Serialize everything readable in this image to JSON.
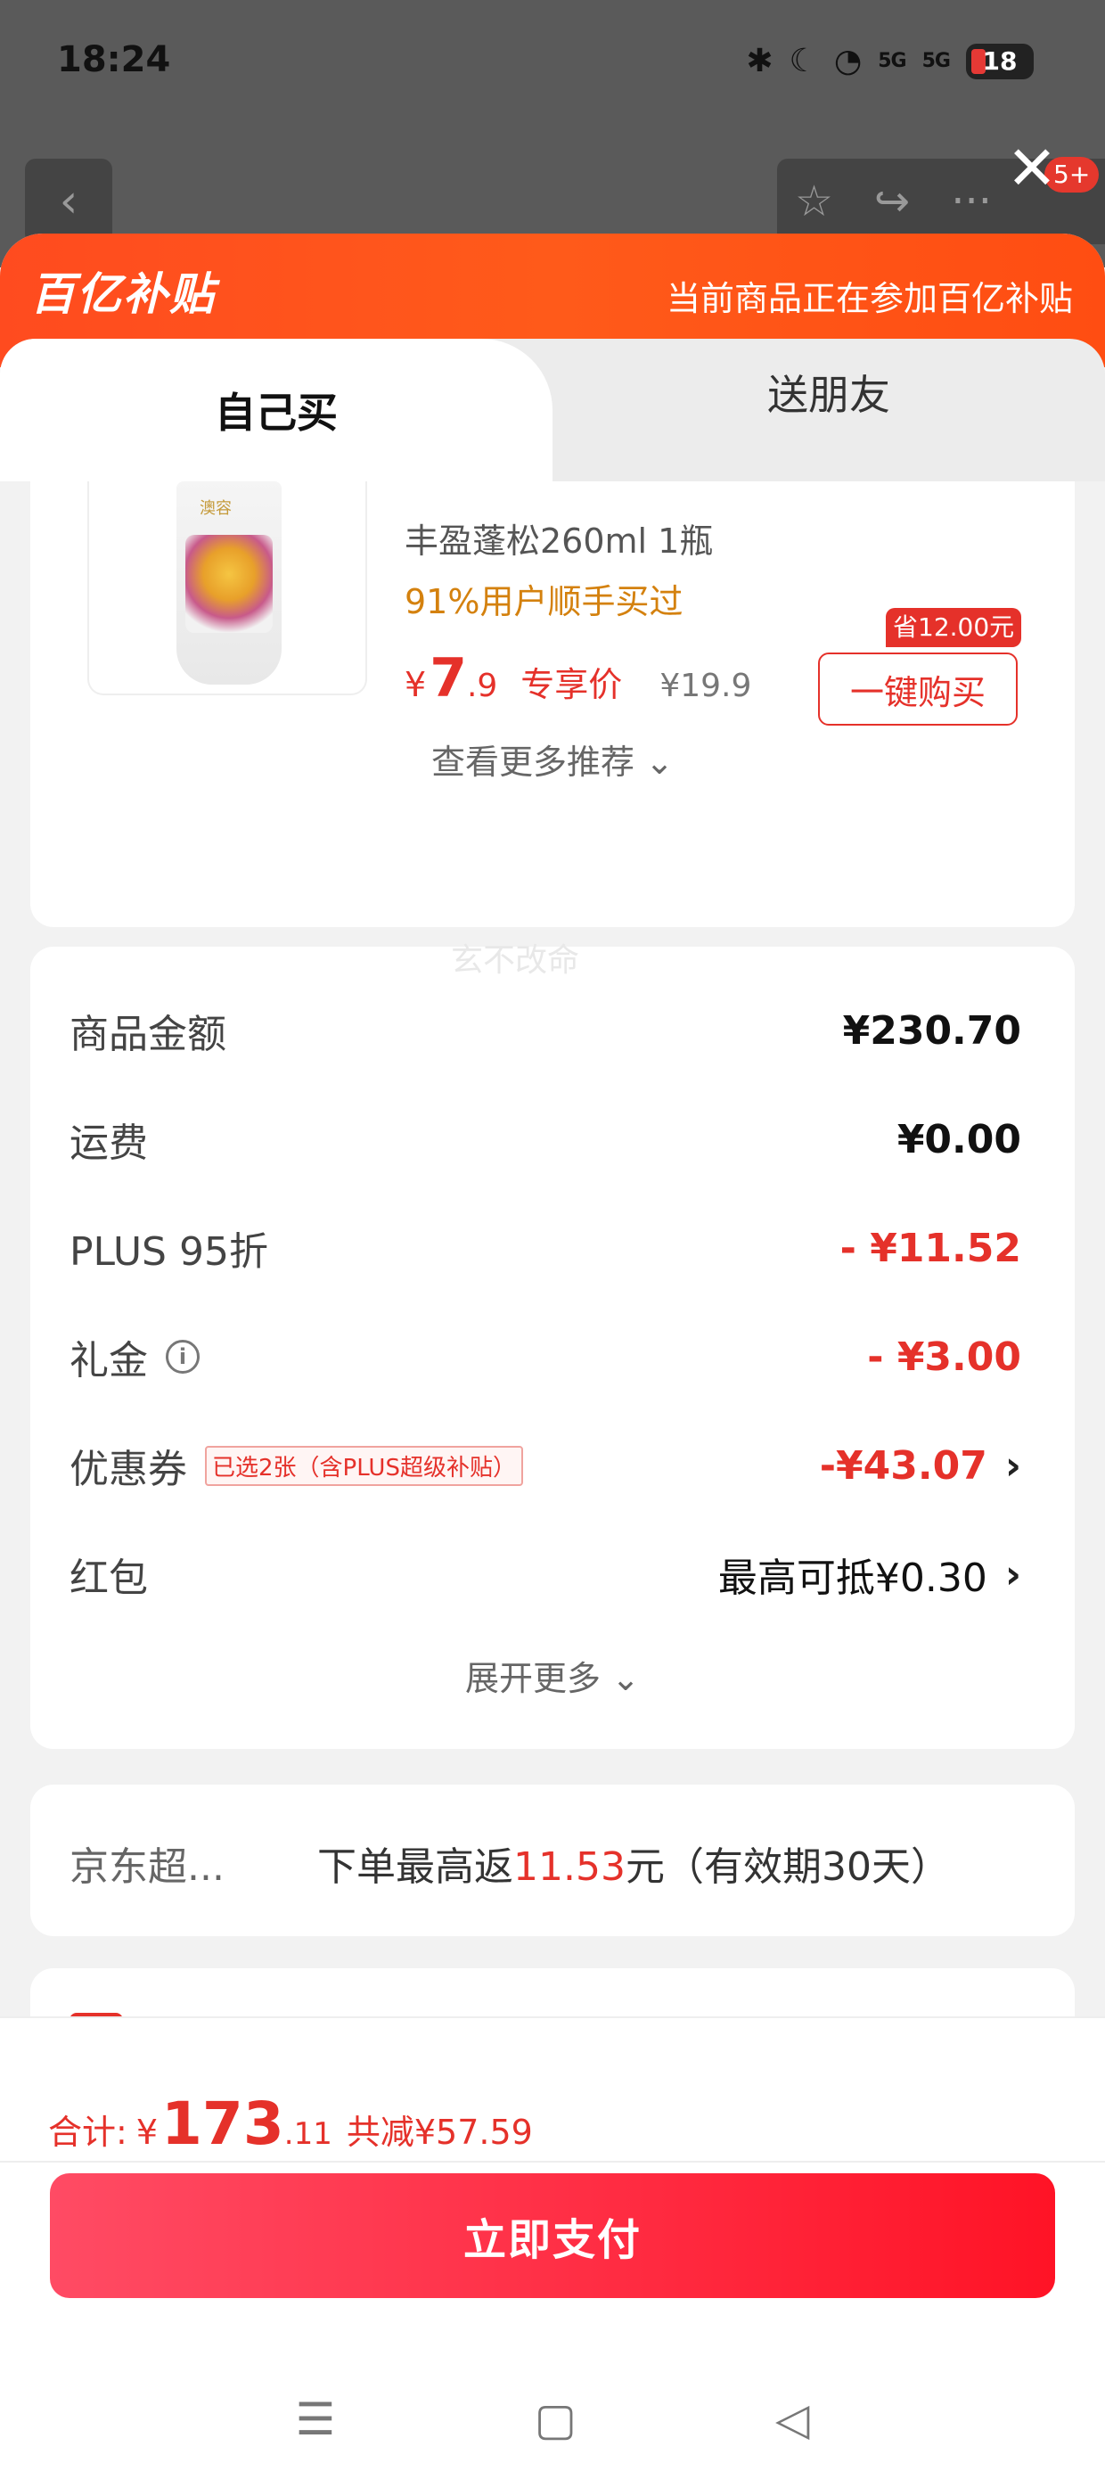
{
  "status_bar": {
    "time": "18:24",
    "icons": [
      "bluetooth-icon",
      "moon-icon",
      "wifi-icon",
      "5g-signal-icon",
      "5g-signal-icon"
    ],
    "signal_label": "5G",
    "battery": "18"
  },
  "nav": {
    "back_icon": "‹",
    "star_icon": "☆",
    "share_icon": "↪",
    "more_icon": "···",
    "close_icon": "✕",
    "badge": "5+"
  },
  "banner": {
    "logo": "百亿补贴",
    "text": "当前商品正在参加百亿补贴"
  },
  "tabs": {
    "self_buy": "自己买",
    "gift": "送朋友"
  },
  "product": {
    "brand": "澳容",
    "title": "丰盈蓬松260ml 1瓶",
    "users": "91%用户顺手买过",
    "price_yen": "¥",
    "price_int": "7",
    "price_dec": ".9",
    "price_tag": "专享价",
    "orig_price": "¥19.9",
    "save_tag": "省12.00元",
    "buy_button": "一键购买",
    "more": "查看更多推荐 ⌄"
  },
  "summary": {
    "rows": [
      {
        "label": "商品金额",
        "value": "¥230.70"
      },
      {
        "label": "运费",
        "value": "¥0.00"
      },
      {
        "label": "PLUS 95折",
        "value": "- ¥11.52"
      },
      {
        "label": "礼金",
        "value": "- ¥3.00"
      },
      {
        "label": "优惠券",
        "value": "-¥43.07",
        "tag": "已选2张（含PLUS超级补贴）"
      },
      {
        "label": "红包",
        "value": "最高可抵¥0.30"
      }
    ],
    "info_icon": "i",
    "chevron": "›",
    "expand": "展开更多 ⌄",
    "watermark": "玄不改命"
  },
  "cashback": {
    "label": "京东超...",
    "text_before": "下单最高返",
    "amount": "11.53",
    "text_after": "元（有效期30天）"
  },
  "footer": {
    "total_label": "合计:",
    "total_yen": "¥",
    "total_int": "173",
    "total_dec": ".11",
    "total_off": "共减¥57.59",
    "pay_button": "立即支付",
    "sys_nav": [
      "☰",
      "▢",
      "◁"
    ]
  },
  "colors": {
    "brand_red": "#e5312a",
    "banner_orange": "#ff4b1f",
    "pay_button": "#ff2a40",
    "price_orange": "#d4810e"
  }
}
